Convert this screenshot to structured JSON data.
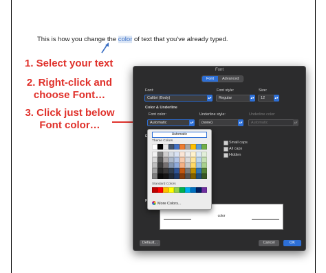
{
  "instruction_text": {
    "before": "This is how you change the ",
    "highlight": "color",
    "after": " of text that you've already typed."
  },
  "steps": {
    "step1": "1. Select your text",
    "step2": "2. Right-click and choose Font…",
    "step3": "3. Click just below Font color…"
  },
  "dialog": {
    "title": "Font",
    "tabs": [
      "Font",
      "Advanced"
    ],
    "font_label": "Font:",
    "font_value": "Calibri (Body)",
    "style_label": "Font style:",
    "style_value": "Regular",
    "size_label": "Size:",
    "size_value": "12",
    "section_color_underline": "Color & Underline",
    "font_color_label": "Font color:",
    "font_color_value": "Automatic",
    "underline_style_label": "Underline style:",
    "underline_style_value": "(none)",
    "underline_color_label": "Underline color:",
    "underline_color_value": "Automatic",
    "effects_section_partial": "Ef",
    "effects": [
      "Small caps",
      "All caps",
      "Hidden"
    ],
    "preview_section_partial": "Pr",
    "preview_text": "color",
    "default_button": "Default...",
    "cancel_button": "Cancel",
    "ok_button": "OK",
    "stepper_glyph": "▴▾"
  },
  "color_popup": {
    "automatic_label": "Automatic",
    "theme_colors_label": "Theme Colors",
    "standard_colors_label": "Standard Colors",
    "more_colors_label": "More Colors...",
    "theme_header_row": [
      "#ffffff",
      "#000000",
      "#e7e6e6",
      "#44546a",
      "#4472c4",
      "#ed7d31",
      "#a5a5a5",
      "#ffc000",
      "#5b9bd5",
      "#70ad47"
    ],
    "theme_shades": [
      [
        "#f2f2f2",
        "#7f7f7f",
        "#d0cece",
        "#d6dce4",
        "#d9e2f3",
        "#fbe5d5",
        "#ededed",
        "#fff2cc",
        "#deebf6",
        "#e2efd9"
      ],
      [
        "#d9d9d9",
        "#595959",
        "#aeaaaa",
        "#adb9ca",
        "#b4c6e7",
        "#f7cbac",
        "#dbdbdb",
        "#fee599",
        "#bdd7ee",
        "#c5e0b3"
      ],
      [
        "#bfbfbf",
        "#3f3f3f",
        "#757070",
        "#8496b0",
        "#8eaadb",
        "#f4b083",
        "#c9c9c9",
        "#ffd965",
        "#9cc3e5",
        "#a8d08d"
      ],
      [
        "#a5a5a5",
        "#262626",
        "#3a3838",
        "#323f4f",
        "#2f5496",
        "#c45911",
        "#7b7b7b",
        "#bf8f00",
        "#2e75b5",
        "#538135"
      ],
      [
        "#7f7f7f",
        "#0c0c0c",
        "#171616",
        "#222a35",
        "#1f3864",
        "#833c0b",
        "#525252",
        "#7f6000",
        "#1f4e79",
        "#375623"
      ]
    ],
    "standard": [
      "#c00000",
      "#ff0000",
      "#ffc000",
      "#ffff00",
      "#92d050",
      "#00b050",
      "#00b0f0",
      "#0070c0",
      "#002060",
      "#7030a0"
    ]
  },
  "colors": {
    "step_text": "#e0312b",
    "dialog_bg": "#2c2c2d",
    "accent": "#2d6fd6"
  }
}
